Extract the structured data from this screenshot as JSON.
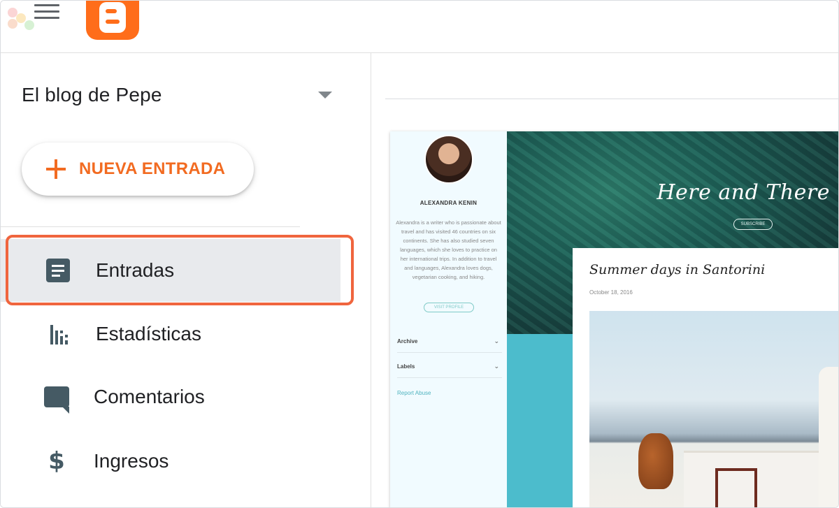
{
  "app": {
    "name": "Blogger"
  },
  "colors": {
    "brand_orange": "#f26b21",
    "logo_orange": "#ff6d1a",
    "highlight": "#f0653e",
    "nav_active_bg": "#e8eaed",
    "icon_gray": "#455a64"
  },
  "header": {
    "menu_icon": "hamburger-icon",
    "logo_icon": "blogger-logo-icon"
  },
  "sidebar": {
    "blog_selector": {
      "value": "El blog de Pepe",
      "icon": "caret-down-icon"
    },
    "new_post": {
      "label": "NUEVA ENTRADA",
      "icon": "plus-icon"
    },
    "items": [
      {
        "label": "Entradas",
        "icon": "posts-icon",
        "active": true
      },
      {
        "label": "Estadísticas",
        "icon": "stats-icon",
        "active": false
      },
      {
        "label": "Comentarios",
        "icon": "comment-icon",
        "active": false
      },
      {
        "label": "Ingresos",
        "icon": "dollar-icon",
        "active": false
      }
    ]
  },
  "preview": {
    "author_name": "ALEXANDRA KENIN",
    "author_bio": "Alexandra is a writer who is passionate about travel and has visited 46 countries on six continents. She has also studied seven languages, which she loves to practice on her international trips. In addition to travel and languages, Alexandra loves dogs, vegetarian cooking, and hiking.",
    "visit_profile": "VISIT PROFILE",
    "archive": "Archive",
    "labels": "Labels",
    "report_abuse": "Report Abuse",
    "blog_title": "Here and There",
    "subscribe": "SUBSCRIBE",
    "post_title": "Summer days in Santorini",
    "post_date": "October 18, 2016"
  }
}
